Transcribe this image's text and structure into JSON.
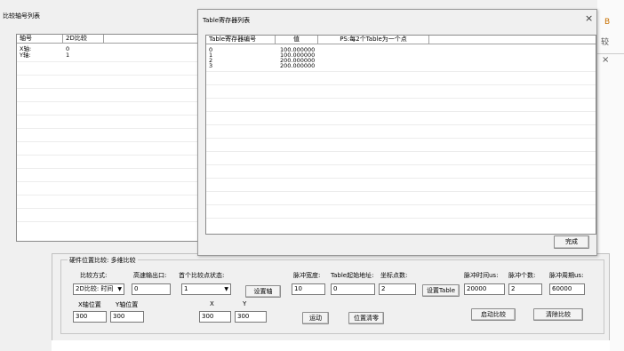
{
  "background": {
    "right_glyph_top": "B",
    "right_glyph_mid": "较",
    "right_close": "×"
  },
  "axis_window": {
    "title": "比较轴号列表",
    "columns": [
      "轴号",
      "2D比较"
    ],
    "rows": [
      {
        "axis": "X轴:",
        "value": "0"
      },
      {
        "axis": "Y轴:",
        "value": "1"
      }
    ]
  },
  "table_window": {
    "title": "Table寄存器列表",
    "close_icon": "close-icon",
    "columns": [
      "Table寄存器编号",
      "值",
      "PS:每2个Table为一个点"
    ],
    "rows": [
      {
        "index": "0",
        "value": "100.000000"
      },
      {
        "index": "1",
        "value": "100.000000"
      },
      {
        "index": "2",
        "value": "200.000000"
      },
      {
        "index": "3",
        "value": "200.000000"
      }
    ],
    "done_label": "完成"
  },
  "settings": {
    "group_title": "硬件位置比较: 多维比较",
    "compare_mode_label": "比较方式:",
    "compare_mode_value": "2D比较: 时间",
    "hs_output_label": "高速输出口:",
    "hs_output_value": "0",
    "first_point_label": "首个比较点状态:",
    "first_point_value": "1",
    "set_axis_label": "设置轴",
    "pulse_width_label": "脉冲宽度:",
    "pulse_width_value": "10",
    "table_start_label": "Table起始地址:",
    "table_start_value": "0",
    "coord_count_label": "坐标点数:",
    "coord_count_value": "2",
    "set_table_label": "设置Table",
    "pulse_time_label": "脉冲时间us:",
    "pulse_time_value": "20000",
    "pulse_count_label": "脉冲个数:",
    "pulse_count_value": "2",
    "pulse_period_label": "脉冲周期us:",
    "pulse_period_value": "60000",
    "x_pos_label": "X轴位置",
    "x_pos_value": "300",
    "y_pos_label": "Y轴位置",
    "y_pos_value": "300",
    "x_label": "X",
    "x_value": "300",
    "y_label": "Y",
    "y_value": "300",
    "move_label": "运动",
    "clear_pos_label": "位置清零",
    "start_compare_label": "启动比较",
    "clear_compare_label": "清除比较"
  }
}
